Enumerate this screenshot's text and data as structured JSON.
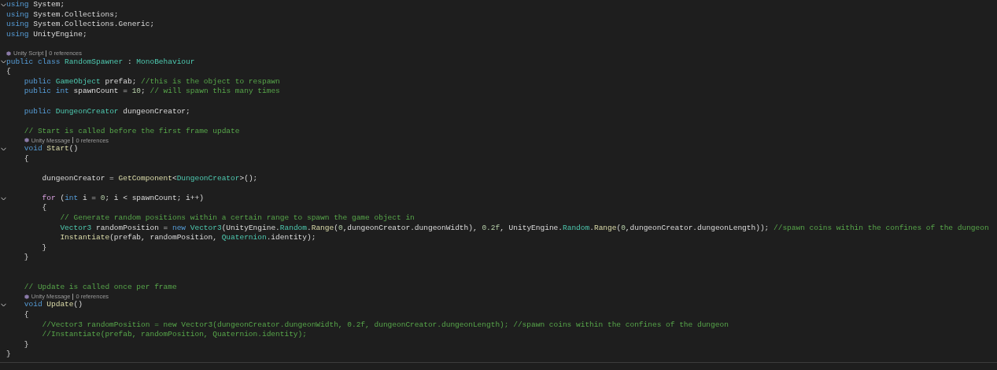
{
  "editor": {
    "lines": [
      {
        "kind": "code",
        "fold": true,
        "tokens": [
          {
            "kind": "kw",
            "text": "using"
          },
          {
            "kind": "plain",
            "text": " System;"
          }
        ]
      },
      {
        "kind": "code",
        "fold": false,
        "tokens": [
          {
            "kind": "kw",
            "text": "using"
          },
          {
            "kind": "plain",
            "text": " System.Collections;"
          }
        ]
      },
      {
        "kind": "code",
        "fold": false,
        "tokens": [
          {
            "kind": "kw",
            "text": "using"
          },
          {
            "kind": "plain",
            "text": " System.Collections.Generic;"
          }
        ]
      },
      {
        "kind": "code",
        "fold": false,
        "tokens": [
          {
            "kind": "kw",
            "text": "using"
          },
          {
            "kind": "plain",
            "text": " UnityEngine;"
          }
        ]
      },
      {
        "kind": "code",
        "fold": false
      },
      {
        "kind": "lens",
        "source": "Unity Script",
        "references": "0 references"
      },
      {
        "kind": "code",
        "fold": true,
        "tokens": [
          {
            "kind": "kw",
            "text": "public class"
          },
          {
            "kind": "type",
            "text": " RandomSpawner"
          },
          {
            "kind": "plain",
            "text": " : "
          },
          {
            "kind": "type",
            "text": "MonoBehaviour"
          }
        ]
      },
      {
        "kind": "code",
        "fold": false,
        "tokens": [
          {
            "kind": "plain",
            "text": "{"
          }
        ]
      },
      {
        "kind": "code",
        "fold": false,
        "tokens": [
          {
            "kind": "kw",
            "text": "    public"
          },
          {
            "kind": "type",
            "text": " GameObject"
          },
          {
            "kind": "plain",
            "text": " prefab; "
          },
          {
            "kind": "comment",
            "text": "//this is the object to respawn"
          }
        ]
      },
      {
        "kind": "code",
        "fold": false,
        "tokens": [
          {
            "kind": "kw",
            "text": "    public int"
          },
          {
            "kind": "plain",
            "text": " spawnCount = "
          },
          {
            "kind": "num",
            "text": "10"
          },
          {
            "kind": "plain",
            "text": "; "
          },
          {
            "kind": "comment",
            "text": "// will spawn this many times"
          }
        ]
      },
      {
        "kind": "code",
        "fold": false
      },
      {
        "kind": "code",
        "fold": false,
        "tokens": [
          {
            "kind": "kw",
            "text": "    public"
          },
          {
            "kind": "type",
            "text": " DungeonCreator"
          },
          {
            "kind": "plain",
            "text": " dungeonCreator;"
          }
        ]
      },
      {
        "kind": "code",
        "fold": false
      },
      {
        "kind": "code",
        "fold": false,
        "tokens": [
          {
            "kind": "comment",
            "text": "    // Start is called before the first frame update"
          }
        ]
      },
      {
        "kind": "lens",
        "source": "Unity Message",
        "references": "0 references"
      },
      {
        "kind": "code",
        "fold": true,
        "tokens": [
          {
            "kind": "kw",
            "text": "    void"
          },
          {
            "kind": "method",
            "text": " Start"
          },
          {
            "kind": "plain",
            "text": "()"
          }
        ]
      },
      {
        "kind": "code",
        "fold": false,
        "tokens": [
          {
            "kind": "plain",
            "text": "    {"
          }
        ]
      },
      {
        "kind": "code",
        "fold": false
      },
      {
        "kind": "code",
        "fold": false,
        "tokens": [
          {
            "kind": "plain",
            "text": "        dungeonCreator = "
          },
          {
            "kind": "method",
            "text": "GetComponent"
          },
          {
            "kind": "plain",
            "text": "<"
          },
          {
            "kind": "type",
            "text": "DungeonCreator"
          },
          {
            "kind": "plain",
            "text": ">();"
          }
        ]
      },
      {
        "kind": "code",
        "fold": false
      },
      {
        "kind": "code",
        "fold": true,
        "tokens": [
          {
            "kind": "ctrl",
            "text": "        for"
          },
          {
            "kind": "plain",
            "text": " ("
          },
          {
            "kind": "kw",
            "text": "int"
          },
          {
            "kind": "plain",
            "text": " i = "
          },
          {
            "kind": "num",
            "text": "0"
          },
          {
            "kind": "plain",
            "text": "; i < spawnCount; i++)"
          }
        ]
      },
      {
        "kind": "code",
        "fold": false,
        "tokens": [
          {
            "kind": "plain",
            "text": "        {"
          }
        ]
      },
      {
        "kind": "code",
        "fold": false,
        "tokens": [
          {
            "kind": "comment",
            "text": "            // Generate random positions within a certain range to spawn the game object in"
          }
        ]
      },
      {
        "kind": "code",
        "fold": false,
        "tokens": [
          {
            "kind": "type",
            "text": "            Vector3"
          },
          {
            "kind": "plain",
            "text": " randomPosition = "
          },
          {
            "kind": "kw",
            "text": "new"
          },
          {
            "kind": "type",
            "text": " Vector3"
          },
          {
            "kind": "plain",
            "text": "(UnityEngine."
          },
          {
            "kind": "type",
            "text": "Random"
          },
          {
            "kind": "plain",
            "text": "."
          },
          {
            "kind": "method",
            "text": "Range"
          },
          {
            "kind": "plain",
            "text": "("
          },
          {
            "kind": "num",
            "text": "0"
          },
          {
            "kind": "plain",
            "text": ",dungeonCreator.dungeonWidth), "
          },
          {
            "kind": "num",
            "text": "0.2f"
          },
          {
            "kind": "plain",
            "text": ", UnityEngine."
          },
          {
            "kind": "type",
            "text": "Random"
          },
          {
            "kind": "plain",
            "text": "."
          },
          {
            "kind": "method",
            "text": "Range"
          },
          {
            "kind": "plain",
            "text": "("
          },
          {
            "kind": "num",
            "text": "0"
          },
          {
            "kind": "plain",
            "text": ",dungeonCreator.dungeonLength)); "
          },
          {
            "kind": "comment",
            "text": "//spawn coins within the confines of the dungeon"
          }
        ]
      },
      {
        "kind": "code",
        "fold": false,
        "tokens": [
          {
            "kind": "method",
            "text": "            Instantiate"
          },
          {
            "kind": "plain",
            "text": "(prefab, randomPosition, "
          },
          {
            "kind": "type",
            "text": "Quaternion"
          },
          {
            "kind": "plain",
            "text": ".identity);"
          }
        ]
      },
      {
        "kind": "code",
        "fold": false,
        "tokens": [
          {
            "kind": "plain",
            "text": "        }"
          }
        ]
      },
      {
        "kind": "code",
        "fold": false,
        "tokens": [
          {
            "kind": "plain",
            "text": "    }"
          }
        ]
      },
      {
        "kind": "code",
        "fold": false
      },
      {
        "kind": "code",
        "fold": false
      },
      {
        "kind": "code",
        "fold": false,
        "tokens": [
          {
            "kind": "comment",
            "text": "    // Update is called once per frame"
          }
        ]
      },
      {
        "kind": "lens",
        "source": "Unity Message",
        "references": "0 references"
      },
      {
        "kind": "code",
        "fold": true,
        "tokens": [
          {
            "kind": "kw",
            "text": "    void"
          },
          {
            "kind": "method",
            "text": " Update"
          },
          {
            "kind": "plain",
            "text": "()"
          }
        ]
      },
      {
        "kind": "code",
        "fold": false,
        "tokens": [
          {
            "kind": "plain",
            "text": "    {"
          }
        ]
      },
      {
        "kind": "code",
        "fold": false,
        "tokens": [
          {
            "kind": "comment",
            "text": "        //Vector3 randomPosition = new Vector3(dungeonCreator.dungeonWidth, 0.2f, dungeonCreator.dungeonLength); //spawn coins within the confines of the dungeon"
          }
        ]
      },
      {
        "kind": "code",
        "fold": false,
        "tokens": [
          {
            "kind": "comment",
            "text": "        //Instantiate(prefab, randomPosition, Quaternion.identity);"
          }
        ]
      },
      {
        "kind": "code",
        "fold": false,
        "tokens": [
          {
            "kind": "plain",
            "text": "    }"
          }
        ]
      },
      {
        "kind": "code",
        "fold": false,
        "tokens": [
          {
            "kind": "plain",
            "text": "}"
          }
        ]
      }
    ]
  }
}
